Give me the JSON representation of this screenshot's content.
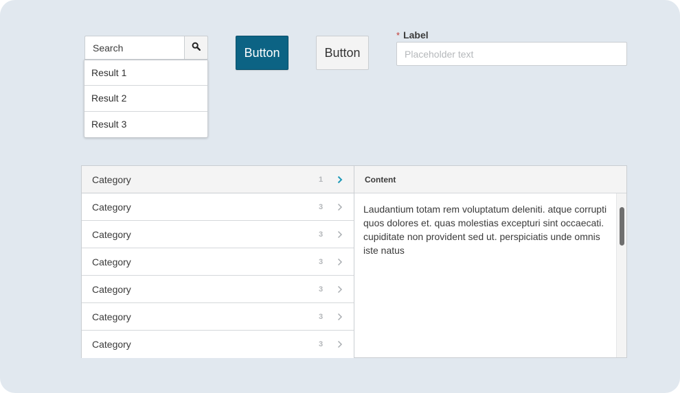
{
  "search": {
    "placeholder": "Search",
    "results": [
      "Result 1",
      "Result 2",
      "Result 3"
    ]
  },
  "buttons": {
    "primary_label": "Button",
    "secondary_label": "Button"
  },
  "field": {
    "required_mark": "*",
    "label": "Label",
    "placeholder": "Placeholder text"
  },
  "categories": [
    {
      "label": "Category",
      "count": "1",
      "active": true
    },
    {
      "label": "Category",
      "count": "3",
      "active": false
    },
    {
      "label": "Category",
      "count": "3",
      "active": false
    },
    {
      "label": "Category",
      "count": "3",
      "active": false
    },
    {
      "label": "Category",
      "count": "3",
      "active": false
    },
    {
      "label": "Category",
      "count": "3",
      "active": false
    },
    {
      "label": "Category",
      "count": "3",
      "active": false
    }
  ],
  "content": {
    "title": "Content",
    "body": "Laudantium totam rem voluptatum deleniti. atque corrupti quos dolores et. quas molestias excepturi sint occaecati. cupiditate non provident sed ut. perspiciatis unde omnis iste natus"
  },
  "colors": {
    "accent": "#0c6384",
    "chevron_active": "#1e9ab8",
    "chevron_inactive": "#a9adb1"
  },
  "icons": {
    "search_button": "search-icon",
    "category_chevron": "chevron-right-icon"
  }
}
